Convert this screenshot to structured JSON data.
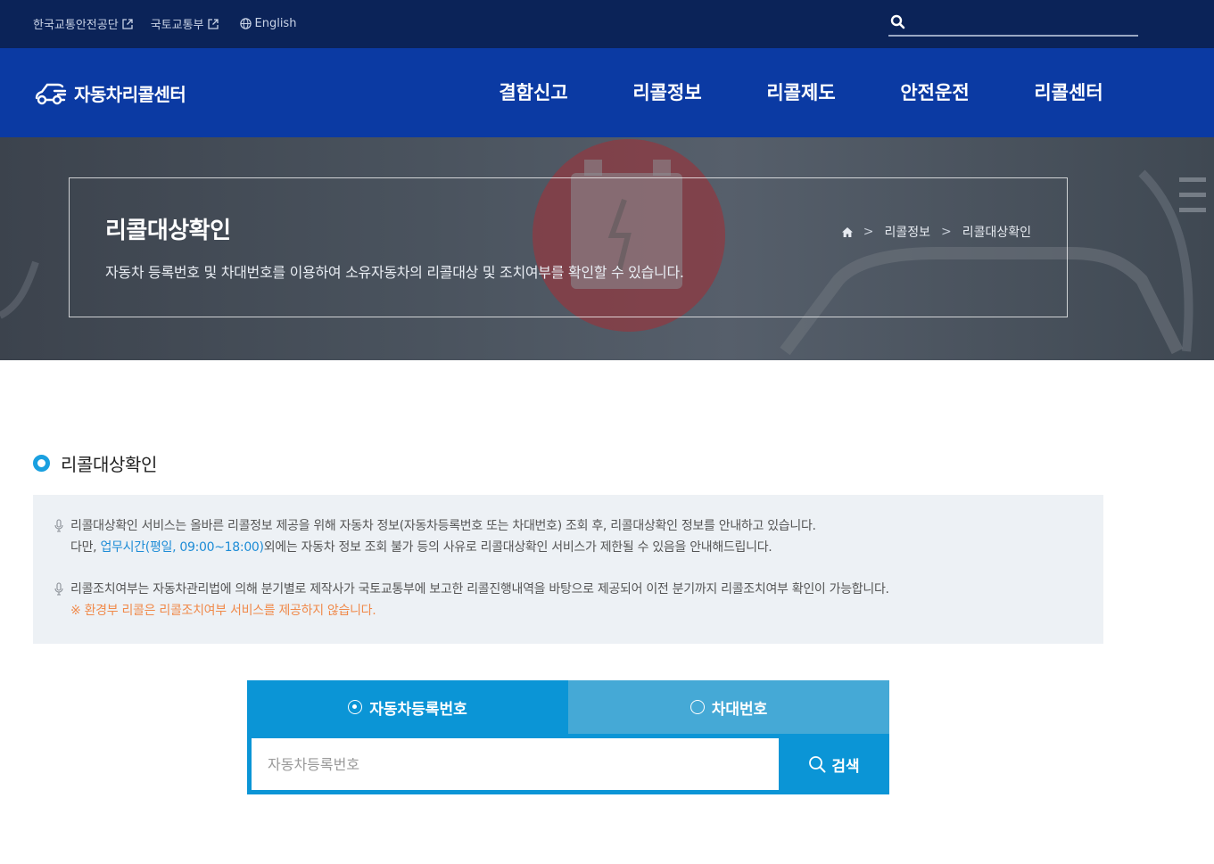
{
  "topbar": {
    "links": [
      {
        "label": "한국교통안전공단",
        "icon": "external-link-icon"
      },
      {
        "label": "국토교통부",
        "icon": "external-link-icon"
      },
      {
        "label": "English",
        "icon": "globe-icon"
      }
    ],
    "search": {
      "icon": "search-icon",
      "value": ""
    }
  },
  "header": {
    "logo_text": "자동차리콜센터",
    "menu": [
      "결함신고",
      "리콜정보",
      "리콜제도",
      "안전운전",
      "리콜센터"
    ]
  },
  "hero": {
    "title": "리콜대상확인",
    "description": "자동차 등록번호 및 차대번호를 이용하여 소유자동차의 리콜대상 및 조치여부를 확인할 수 있습니다.",
    "breadcrumb": [
      "리콜정보",
      "리콜대상확인"
    ],
    "breadcrumb_home_icon": "home-icon"
  },
  "section": {
    "title": "리콜대상확인",
    "notice": {
      "item1_line1": "리콜대상확인 서비스는 올바른 리콜정보 제공을 위해 자동차 정보(자동차등록번호 또는 차대번호) 조회 후, 리콜대상확인 정보를 안내하고 있습니다.",
      "item1_line2_prefix": "다만, ",
      "item1_line2_highlight": "업무시간(평일, 09:00~18:00)",
      "item1_line2_suffix": "외에는 자동차 정보 조회 불가 등의 사유로 리콜대상확인 서비스가 제한될 수 있음을 안내해드립니다.",
      "item2_line1": "리콜조치여부는 자동차관리법에 의해 분기별로 제작사가 국토교통부에 보고한 리콜진행내역을 바탕으로 제공되어 이전 분기까지 리콜조치여부 확인이 가능합니다.",
      "item2_line2": "※ 환경부 리콜은 리콜조치여부 서비스를 제공하지 않습니다."
    }
  },
  "search_widget": {
    "tabs": [
      {
        "label": "자동차등록번호",
        "selected": true
      },
      {
        "label": "차대번호",
        "selected": false
      }
    ],
    "input_placeholder": "자동차등록번호",
    "input_value": "",
    "button_label": "검색"
  },
  "colors": {
    "topbar": "#0b2358",
    "navbar": "#0b3aa3",
    "tab_active": "#0b95d6",
    "tab_inactive": "#45a9d6",
    "highlight_blue": "#1d8cd6",
    "highlight_orange": "#f08a4b"
  }
}
